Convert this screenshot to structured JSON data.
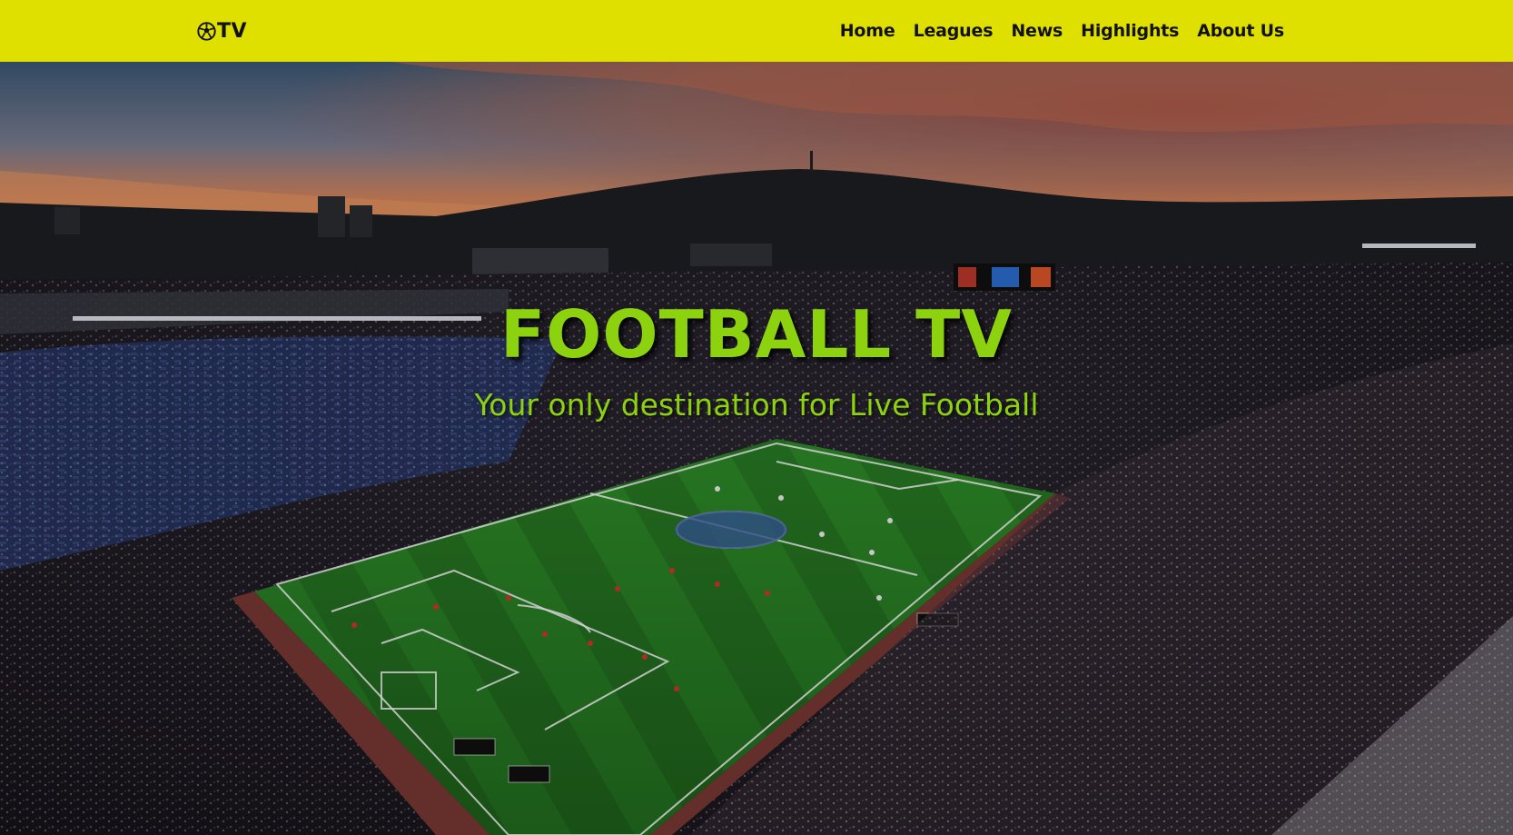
{
  "brand": {
    "icon": "soccer-ball-icon",
    "text": "TV"
  },
  "nav": {
    "items": [
      {
        "label": "Home"
      },
      {
        "label": "Leagues"
      },
      {
        "label": "News"
      },
      {
        "label": "Highlights"
      },
      {
        "label": "About Us"
      }
    ]
  },
  "hero": {
    "title": "FOOTBALL TV",
    "subtitle": "Your only destination for Live Football",
    "background": "stadium-at-sunset-image"
  },
  "colors": {
    "navbar_bg": "#dfe000",
    "nav_text": "#111111",
    "hero_text": "#8cd20f"
  }
}
